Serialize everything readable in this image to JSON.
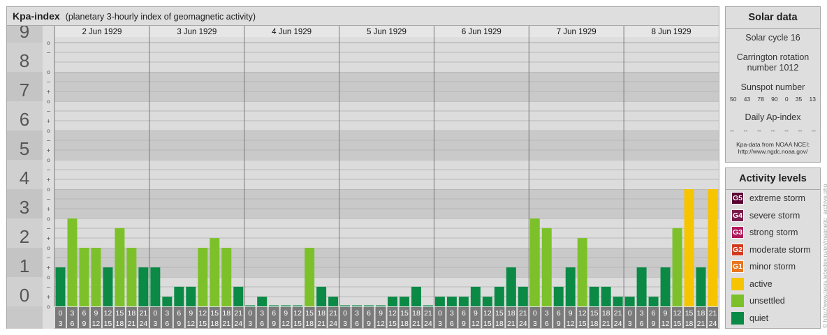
{
  "title": "Kpa-index",
  "subtitle": "(planetary 3-hourly index of geomagnetic activity)",
  "chart_data": {
    "type": "bar",
    "title": "Kpa-index",
    "subtitle": "(planetary 3-hourly index of geomagnetic activity)",
    "ylim": [
      0,
      9
    ],
    "y_tick_labels": [
      "0",
      "1",
      "2",
      "3",
      "4",
      "5",
      "6",
      "7",
      "8",
      "9"
    ],
    "minor_tick_labels": [
      "+",
      "o",
      "−"
    ],
    "days": [
      "2 Jun 1929",
      "3 Jun 1929",
      "4 Jun 1929",
      "5 Jun 1929",
      "6 Jun 1929",
      "7 Jun 1929",
      "8 Jun 1929"
    ],
    "interval_start_labels": [
      "0",
      "3",
      "6",
      "9",
      "12",
      "15",
      "18",
      "21"
    ],
    "interval_end_labels": [
      "3",
      "6",
      "9",
      "12",
      "15",
      "18",
      "21",
      "24"
    ],
    "values": [
      1.33,
      3.0,
      2.0,
      2.0,
      1.33,
      2.67,
      2.0,
      1.33,
      1.33,
      0.33,
      0.67,
      0.67,
      2.0,
      2.33,
      2.0,
      0.67,
      0.0,
      0.33,
      0.0,
      0.0,
      0.0,
      2.0,
      0.67,
      0.33,
      0.0,
      0.0,
      0.0,
      0.0,
      0.33,
      0.33,
      0.67,
      0.0,
      0.33,
      0.33,
      0.33,
      0.67,
      0.33,
      0.67,
      1.33,
      0.67,
      3.0,
      2.67,
      0.67,
      1.33,
      2.33,
      0.67,
      0.67,
      0.33,
      0.33,
      1.33,
      0.33,
      1.33,
      2.67,
      4.0,
      1.33,
      4.0
    ],
    "colors": {
      "quiet": "#0a8a45",
      "unsettled": "#7dc12a",
      "active": "#f6c400"
    }
  },
  "solar": {
    "title": "Solar data",
    "solar_cycle": "Solar cycle 16",
    "carrington_line1": "Carrington rotation",
    "carrington_line2": "number 1012",
    "sunspot_title": "Sunspot number",
    "sunspot_values": [
      "50",
      "43",
      "78",
      "90",
      "0",
      "35",
      "13"
    ],
    "ap_title": "Daily Ap-index",
    "ap_values": [
      "--",
      "--",
      "--",
      "--",
      "--",
      "--",
      "--"
    ],
    "credit_line1": "Kpa-data from NOAA NCEI:",
    "credit_line2": "http://www.ngdc.noaa.gov/"
  },
  "activity": {
    "title": "Activity levels",
    "levels": [
      {
        "code": "G5",
        "label": "extreme storm",
        "color": "#5a0033"
      },
      {
        "code": "G4",
        "label": "severe storm",
        "color": "#7a1a4a"
      },
      {
        "code": "G3",
        "label": "strong storm",
        "color": "#b0195a"
      },
      {
        "code": "G2",
        "label": "moderate storm",
        "color": "#d2391e"
      },
      {
        "code": "G1",
        "label": "minor storm",
        "color": "#e8761e"
      },
      {
        "code": "",
        "label": "active",
        "color": "#f6c400"
      },
      {
        "code": "",
        "label": "unsettled",
        "color": "#7dc12a"
      },
      {
        "code": "",
        "label": "quiet",
        "color": "#0a8a45"
      }
    ]
  },
  "watermark": "© http://www.tesis.lebedev.ru/en/magnetic_archive.php"
}
